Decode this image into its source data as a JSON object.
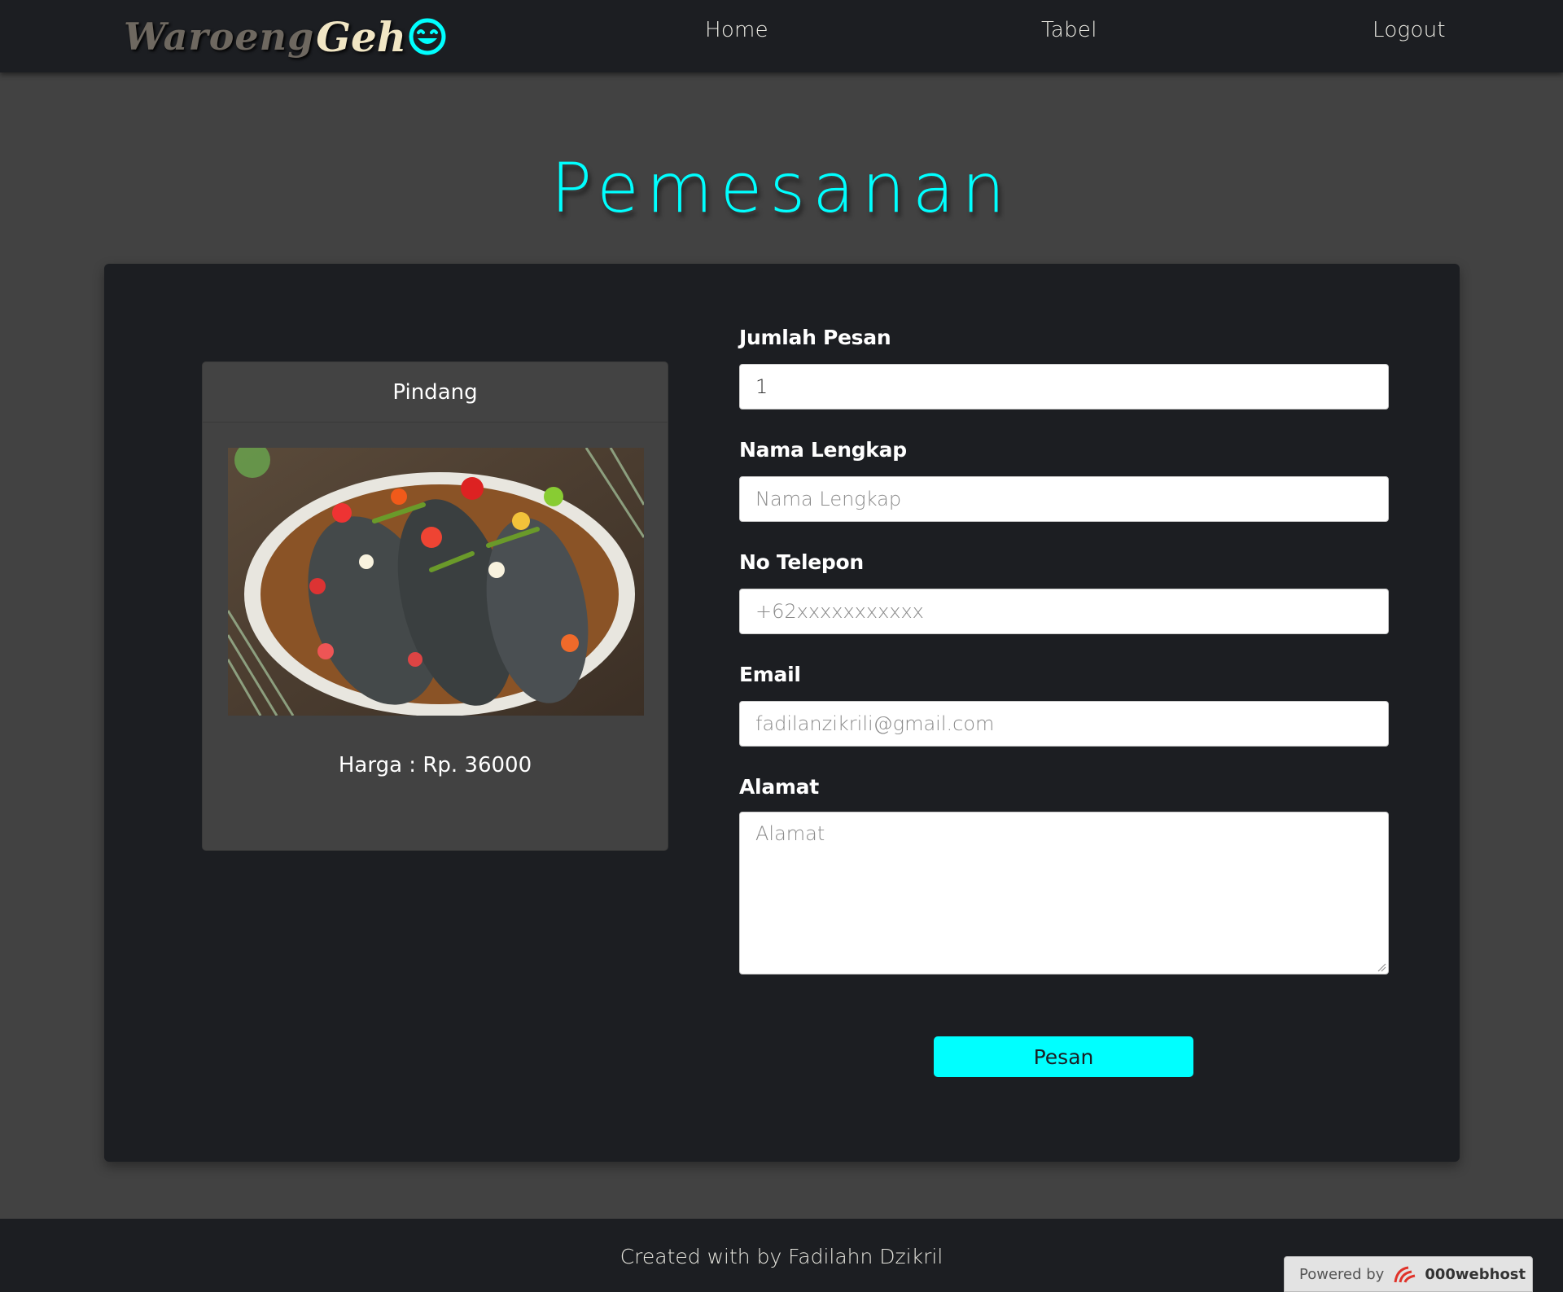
{
  "nav": {
    "brand_part1": "Waroeng",
    "brand_part2": "Geh",
    "links": [
      "Home",
      "Tabel",
      "Logout"
    ]
  },
  "page": {
    "title": "Pemesanan"
  },
  "product": {
    "name": "Pindang",
    "price_label": "Harga : Rp. 36000"
  },
  "form": {
    "quantity": {
      "label": "Jumlah Pesan",
      "value": "1"
    },
    "name": {
      "label": "Nama Lengkap",
      "placeholder": "Nama Lengkap"
    },
    "phone": {
      "label": "No Telepon",
      "placeholder": "+62xxxxxxxxxxx"
    },
    "email": {
      "label": "Email",
      "placeholder": "fadilanzikrili@gmail.com"
    },
    "address": {
      "label": "Alamat",
      "placeholder": "Alamat"
    },
    "submit_label": "Pesan"
  },
  "footer": {
    "credit": "Created with by Fadilahn Dzikril",
    "badge_prefix": "Powered by",
    "badge_brand": "000webhost"
  },
  "colors": {
    "accent": "#00ffff",
    "navbar_bg": "#1c1e22",
    "page_bg": "#424242",
    "panel_bg": "#1c1e22",
    "card_bg": "#424242"
  },
  "icons": {
    "brand_emoji": "smiley-icon",
    "resize": "resize-grip-icon",
    "host_logo": "webhost-logo-icon"
  }
}
